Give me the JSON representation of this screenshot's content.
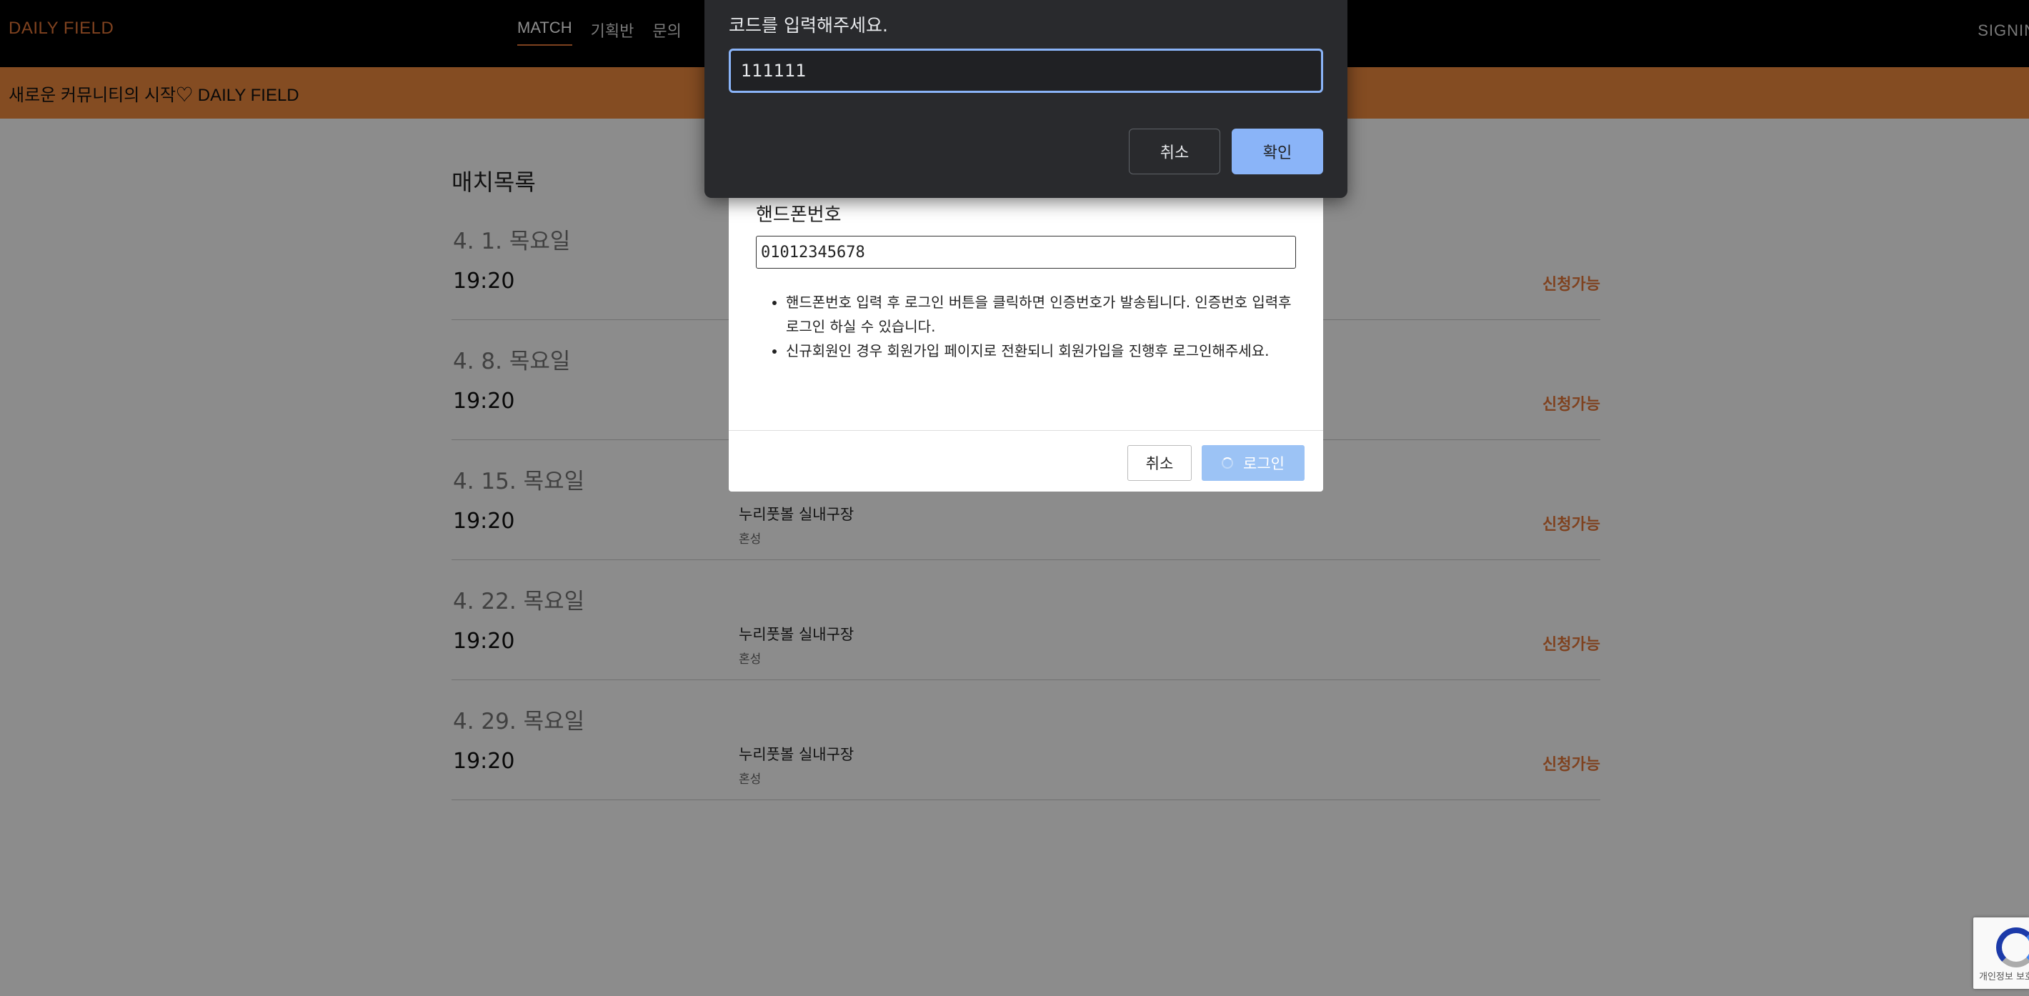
{
  "nav": {
    "brand": "DAILY FIELD",
    "links": [
      "MATCH",
      "기획반",
      "문의"
    ],
    "signin": "SIGNIN"
  },
  "banner": {
    "text": "새로운 커뮤니티의 시작♡ DAILY FIELD"
  },
  "main": {
    "title": "매치목록",
    "days": [
      {
        "date": "4. 1. 목요일",
        "time": "19:20",
        "venue": "",
        "type": "",
        "status": "신청가능"
      },
      {
        "date": "4. 8. 목요일",
        "time": "19:20",
        "venue": "",
        "type": "",
        "status": "신청가능"
      },
      {
        "date": "4. 15. 목요일",
        "time": "19:20",
        "venue": "누리풋볼 실내구장",
        "type": "혼성",
        "status": "신청가능"
      },
      {
        "date": "4. 22. 목요일",
        "time": "19:20",
        "venue": "누리풋볼 실내구장",
        "type": "혼성",
        "status": "신청가능"
      },
      {
        "date": "4. 29. 목요일",
        "time": "19:20",
        "venue": "누리풋볼 실내구장",
        "type": "혼성",
        "status": "신청가능"
      }
    ]
  },
  "login_modal": {
    "label": "핸드폰번호",
    "phone_value": "01012345678",
    "notes": [
      "핸드폰번호 입력 후 로그인 버튼을 클릭하면 인증번호가 발송됩니다. 인증번호 입력후 로그인 하실 수 있습니다.",
      "신규회원인 경우 회원가입 페이지로 전환되니 회원가입을 진행후 로그인해주세요."
    ],
    "cancel_label": "취소",
    "login_label": "로그인"
  },
  "prompt": {
    "message": "코드를 입력해주세요.",
    "value": "111111",
    "cancel_label": "취소",
    "ok_label": "확인"
  },
  "recaptcha": {
    "text": "개인정보 보호"
  }
}
